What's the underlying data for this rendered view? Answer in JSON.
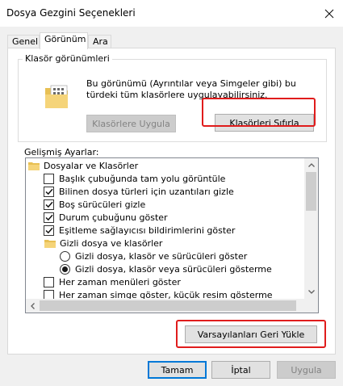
{
  "window": {
    "title": "Dosya Gezgini Seçenekleri"
  },
  "tabs": [
    {
      "label": "Genel"
    },
    {
      "label": "Görünüm"
    },
    {
      "label": "Ara"
    }
  ],
  "folder_views": {
    "label": "Klasör görünümleri",
    "description": "Bu görünümü (Ayrıntılar veya Simgeler gibi) bu türdeki tüm klasörlere uygulayabilirsiniz.",
    "apply_button": "Klasörlere Uygula",
    "reset_button": "Klasörleri Sıfırla"
  },
  "advanced": {
    "label": "Gelişmiş Ayarlar:",
    "items": [
      {
        "type": "folder",
        "label": "Dosyalar ve Klasörler"
      },
      {
        "type": "checkbox",
        "label": "Başlık çubuğunda tam yolu görüntüle",
        "checked": false
      },
      {
        "type": "checkbox",
        "label": "Bilinen dosya türleri için uzantıları gizle",
        "checked": true
      },
      {
        "type": "checkbox",
        "label": "Boş sürücüleri gizle",
        "checked": true
      },
      {
        "type": "checkbox",
        "label": "Durum çubuğunu göster",
        "checked": true
      },
      {
        "type": "checkbox",
        "label": "Eşitleme sağlayıcısı bildirimlerini göster",
        "checked": true
      },
      {
        "type": "folder",
        "label": "Gizli dosya ve klasörler"
      },
      {
        "type": "radio",
        "label": "Gizli dosya, klasör ve sürücüleri göster",
        "checked": false
      },
      {
        "type": "radio",
        "label": "Gizli dosya, klasör veya sürücüleri gösterme",
        "checked": true
      },
      {
        "type": "checkbox",
        "label": "Her zaman menüleri göster",
        "checked": false
      },
      {
        "type": "checkbox",
        "label": "Her zaman simge göster, küçük resim gösterme",
        "checked": false
      }
    ],
    "restore_button": "Varsayılanları Geri Yükle"
  },
  "footer": {
    "ok_button": "Tamam",
    "cancel_button": "İptal",
    "apply_button": "Uygula"
  },
  "colors": {
    "highlight": "#e01c1c",
    "accent": "#0078d7"
  }
}
